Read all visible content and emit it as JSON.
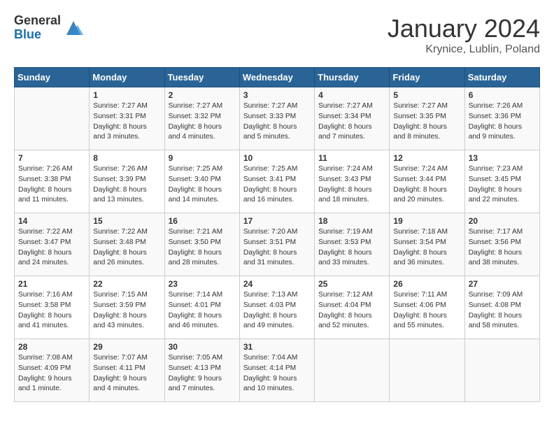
{
  "header": {
    "logo_general": "General",
    "logo_blue": "Blue",
    "title": "January 2024",
    "location": "Krynice, Lublin, Poland"
  },
  "calendar": {
    "days_of_week": [
      "Sunday",
      "Monday",
      "Tuesday",
      "Wednesday",
      "Thursday",
      "Friday",
      "Saturday"
    ],
    "weeks": [
      [
        {
          "day": "",
          "info": ""
        },
        {
          "day": "1",
          "info": "Sunrise: 7:27 AM\nSunset: 3:31 PM\nDaylight: 8 hours\nand 3 minutes."
        },
        {
          "day": "2",
          "info": "Sunrise: 7:27 AM\nSunset: 3:32 PM\nDaylight: 8 hours\nand 4 minutes."
        },
        {
          "day": "3",
          "info": "Sunrise: 7:27 AM\nSunset: 3:33 PM\nDaylight: 8 hours\nand 5 minutes."
        },
        {
          "day": "4",
          "info": "Sunrise: 7:27 AM\nSunset: 3:34 PM\nDaylight: 8 hours\nand 7 minutes."
        },
        {
          "day": "5",
          "info": "Sunrise: 7:27 AM\nSunset: 3:35 PM\nDaylight: 8 hours\nand 8 minutes."
        },
        {
          "day": "6",
          "info": "Sunrise: 7:26 AM\nSunset: 3:36 PM\nDaylight: 8 hours\nand 9 minutes."
        }
      ],
      [
        {
          "day": "7",
          "info": "Sunrise: 7:26 AM\nSunset: 3:38 PM\nDaylight: 8 hours\nand 11 minutes."
        },
        {
          "day": "8",
          "info": "Sunrise: 7:26 AM\nSunset: 3:39 PM\nDaylight: 8 hours\nand 13 minutes."
        },
        {
          "day": "9",
          "info": "Sunrise: 7:25 AM\nSunset: 3:40 PM\nDaylight: 8 hours\nand 14 minutes."
        },
        {
          "day": "10",
          "info": "Sunrise: 7:25 AM\nSunset: 3:41 PM\nDaylight: 8 hours\nand 16 minutes."
        },
        {
          "day": "11",
          "info": "Sunrise: 7:24 AM\nSunset: 3:43 PM\nDaylight: 8 hours\nand 18 minutes."
        },
        {
          "day": "12",
          "info": "Sunrise: 7:24 AM\nSunset: 3:44 PM\nDaylight: 8 hours\nand 20 minutes."
        },
        {
          "day": "13",
          "info": "Sunrise: 7:23 AM\nSunset: 3:45 PM\nDaylight: 8 hours\nand 22 minutes."
        }
      ],
      [
        {
          "day": "14",
          "info": "Sunrise: 7:22 AM\nSunset: 3:47 PM\nDaylight: 8 hours\nand 24 minutes."
        },
        {
          "day": "15",
          "info": "Sunrise: 7:22 AM\nSunset: 3:48 PM\nDaylight: 8 hours\nand 26 minutes."
        },
        {
          "day": "16",
          "info": "Sunrise: 7:21 AM\nSunset: 3:50 PM\nDaylight: 8 hours\nand 28 minutes."
        },
        {
          "day": "17",
          "info": "Sunrise: 7:20 AM\nSunset: 3:51 PM\nDaylight: 8 hours\nand 31 minutes."
        },
        {
          "day": "18",
          "info": "Sunrise: 7:19 AM\nSunset: 3:53 PM\nDaylight: 8 hours\nand 33 minutes."
        },
        {
          "day": "19",
          "info": "Sunrise: 7:18 AM\nSunset: 3:54 PM\nDaylight: 8 hours\nand 36 minutes."
        },
        {
          "day": "20",
          "info": "Sunrise: 7:17 AM\nSunset: 3:56 PM\nDaylight: 8 hours\nand 38 minutes."
        }
      ],
      [
        {
          "day": "21",
          "info": "Sunrise: 7:16 AM\nSunset: 3:58 PM\nDaylight: 8 hours\nand 41 minutes."
        },
        {
          "day": "22",
          "info": "Sunrise: 7:15 AM\nSunset: 3:59 PM\nDaylight: 8 hours\nand 43 minutes."
        },
        {
          "day": "23",
          "info": "Sunrise: 7:14 AM\nSunset: 4:01 PM\nDaylight: 8 hours\nand 46 minutes."
        },
        {
          "day": "24",
          "info": "Sunrise: 7:13 AM\nSunset: 4:03 PM\nDaylight: 8 hours\nand 49 minutes."
        },
        {
          "day": "25",
          "info": "Sunrise: 7:12 AM\nSunset: 4:04 PM\nDaylight: 8 hours\nand 52 minutes."
        },
        {
          "day": "26",
          "info": "Sunrise: 7:11 AM\nSunset: 4:06 PM\nDaylight: 8 hours\nand 55 minutes."
        },
        {
          "day": "27",
          "info": "Sunrise: 7:09 AM\nSunset: 4:08 PM\nDaylight: 8 hours\nand 58 minutes."
        }
      ],
      [
        {
          "day": "28",
          "info": "Sunrise: 7:08 AM\nSunset: 4:09 PM\nDaylight: 9 hours\nand 1 minute."
        },
        {
          "day": "29",
          "info": "Sunrise: 7:07 AM\nSunset: 4:11 PM\nDaylight: 9 hours\nand 4 minutes."
        },
        {
          "day": "30",
          "info": "Sunrise: 7:05 AM\nSunset: 4:13 PM\nDaylight: 9 hours\nand 7 minutes."
        },
        {
          "day": "31",
          "info": "Sunrise: 7:04 AM\nSunset: 4:14 PM\nDaylight: 9 hours\nand 10 minutes."
        },
        {
          "day": "",
          "info": ""
        },
        {
          "day": "",
          "info": ""
        },
        {
          "day": "",
          "info": ""
        }
      ]
    ]
  }
}
